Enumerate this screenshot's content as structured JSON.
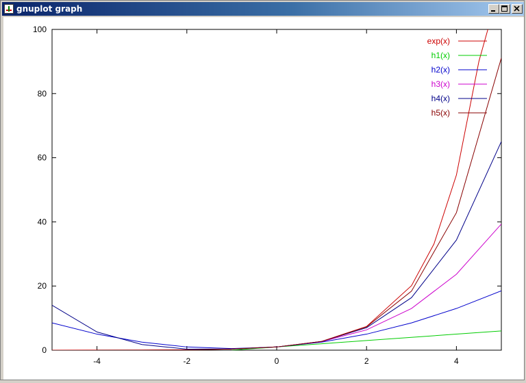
{
  "window": {
    "title": "gnuplot graph",
    "minimize_icon": "minimize-icon",
    "maximize_icon": "maximize-icon",
    "close_icon": "close-icon"
  },
  "chart_data": {
    "type": "line",
    "title": "",
    "xlabel": "",
    "ylabel": "",
    "xlim": [
      -5,
      5
    ],
    "ylim": [
      0,
      100
    ],
    "xticks": [
      -4,
      -2,
      0,
      2,
      4
    ],
    "xtick_labels": [
      "-4",
      "-2",
      "0",
      "2",
      "4"
    ],
    "yticks": [
      0,
      20,
      40,
      60,
      80,
      100
    ],
    "ytick_labels": [
      "0",
      "20",
      "40",
      "60",
      "80",
      "100"
    ],
    "grid": false,
    "legend_position": "top-right",
    "series": [
      {
        "name": "exp(x)",
        "color": "#cc0000",
        "x": [
          -5,
          -4,
          -3,
          -2,
          -1,
          0,
          1,
          2,
          3,
          3.5,
          4,
          4.5,
          4.7
        ],
        "y": [
          0.007,
          0.018,
          0.05,
          0.14,
          0.37,
          1,
          2.72,
          7.39,
          20.1,
          33.1,
          54.6,
          90,
          100
        ]
      },
      {
        "name": "h1(x)",
        "color": "#00cc00",
        "x": [
          -1,
          0,
          1,
          2,
          3,
          4,
          5
        ],
        "y": [
          0,
          1,
          2,
          3,
          4,
          5,
          6
        ]
      },
      {
        "name": "h2(x)",
        "color": "#0000cc",
        "x": [
          -5,
          -4,
          -3,
          -2,
          -1,
          0,
          1,
          2,
          3,
          4,
          5
        ],
        "y": [
          8.5,
          5,
          2.5,
          1,
          0.5,
          1,
          2.5,
          5,
          8.5,
          13,
          18.5
        ]
      },
      {
        "name": "h3(x)",
        "color": "#cc00cc",
        "x": [
          -1,
          0,
          1,
          2,
          3,
          4,
          5
        ],
        "y": [
          0.333,
          1,
          2.667,
          6.333,
          13,
          23.667,
          39.333
        ]
      },
      {
        "name": "h4(x)",
        "color": "#000088",
        "x": [
          -5,
          -4,
          -3,
          -2,
          -1,
          0,
          1,
          2,
          3,
          4,
          5
        ],
        "y": [
          14,
          5.67,
          1.75,
          0.333,
          0.375,
          1,
          2.708,
          7,
          16.375,
          34.333,
          65.042
        ]
      },
      {
        "name": "h5(x)",
        "color": "#880000",
        "x": [
          -4,
          -3,
          -2,
          -1,
          0,
          1,
          2,
          3,
          4,
          5
        ],
        "y": [
          0,
          0,
          0.067,
          0.367,
          1,
          2.717,
          7.267,
          18.4,
          42.867,
          91.083
        ]
      }
    ]
  }
}
